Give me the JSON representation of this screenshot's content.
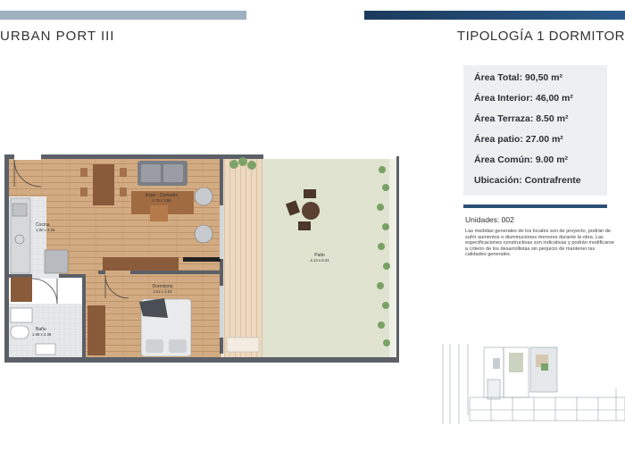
{
  "header": {
    "project_name": "URBAN PORT III",
    "typology": "TIPOLOGÍA 1 DORMITOR"
  },
  "specs": [
    {
      "label": "Área Total: 90,50 m²"
    },
    {
      "label": "Área Interior: 46,00 m²"
    },
    {
      "label": "Área Terraza: 8.50 m²"
    },
    {
      "label": "Área patio: 27.00 m²"
    },
    {
      "label": "Área Común: 9.00 m²"
    },
    {
      "label": "Ubicación: Contrafrente"
    }
  ],
  "units_label": "Unidades: 002",
  "notes": "Las medidas generales de los locales son de proyecto, podrán de sufrir aumentos o disminuciones menores durante la obra. Las especificaciones constructivas son indicativas y podrán modificarse a criterio de los desarrollistas sin perjuicio de mantener las calidades generales.",
  "plan_labels": {
    "estar_name": "Estar - Comedor",
    "estar_dims": "4.75 x 3.59",
    "cocina_name": "Cocina",
    "cocina_dims": "1.80 x 2.26",
    "dormitorio_name": "Dormitorio",
    "dormitorio_dims": "3.62 x 2.63",
    "bano_name": "Baño",
    "bano_dims": "1.68 x 2.38",
    "patio_name": "Patio",
    "patio_dims": "4.13 x 6.31"
  },
  "colors": {
    "wood_floor": "#cfa880",
    "wall": "#5b6068",
    "patio_grass": "#dfe3cf",
    "deck": "#ecd9bf",
    "accent_dark": "#2c5177",
    "bar_light": "#9fb0bf"
  }
}
